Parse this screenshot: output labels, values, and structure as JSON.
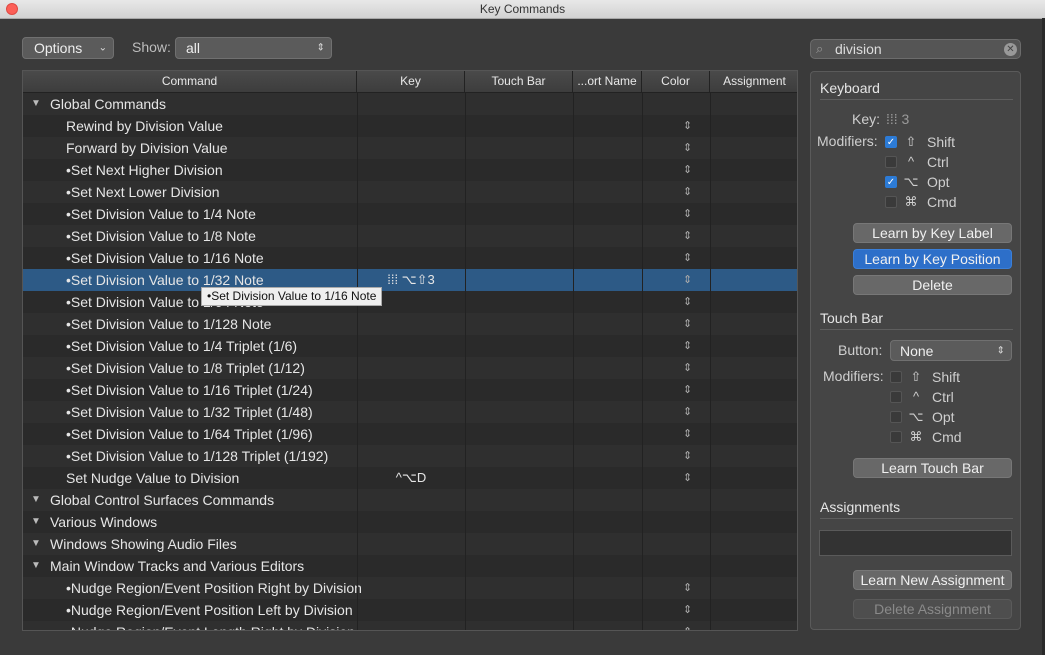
{
  "window": {
    "title": "Key Commands"
  },
  "toolbar": {
    "options_label": "Options",
    "show_label": "Show:",
    "show_value": "all",
    "search_value": "division"
  },
  "table": {
    "headers": [
      "Command",
      "Key",
      "Touch Bar",
      "...ort Name",
      "Color",
      "Assignment"
    ],
    "rows": [
      {
        "text": "Global Commands",
        "key": "",
        "level": 0,
        "group": true,
        "chev": false
      },
      {
        "text": "Rewind by Division Value",
        "key": "",
        "level": 1,
        "chev": true
      },
      {
        "text": "Forward by Division Value",
        "key": "",
        "level": 1,
        "chev": true
      },
      {
        "text": "•Set Next Higher Division",
        "key": "",
        "level": 1,
        "chev": true
      },
      {
        "text": "•Set Next Lower Division",
        "key": "",
        "level": 1,
        "chev": true
      },
      {
        "text": "•Set Division Value to 1/4 Note",
        "key": "",
        "level": 1,
        "chev": true
      },
      {
        "text": "•Set Division Value to 1/8 Note",
        "key": "",
        "level": 1,
        "chev": true
      },
      {
        "text": "•Set Division Value to 1/16 Note",
        "key": "",
        "level": 1,
        "chev": true
      },
      {
        "text": "•Set Division Value to 1/32 Note",
        "key": "⁞⁞⁞ ⌥⇧3",
        "level": 1,
        "chev": true,
        "selected": true
      },
      {
        "text": "•Set Division Value to 1/64 Note",
        "key": "",
        "level": 1,
        "chev": true
      },
      {
        "text": "•Set Division Value to 1/128 Note",
        "key": "",
        "level": 1,
        "chev": true
      },
      {
        "text": "•Set Division Value to 1/4 Triplet (1/6)",
        "key": "",
        "level": 1,
        "chev": true
      },
      {
        "text": "•Set Division Value to 1/8 Triplet (1/12)",
        "key": "",
        "level": 1,
        "chev": true
      },
      {
        "text": "•Set Division Value to 1/16 Triplet (1/24)",
        "key": "",
        "level": 1,
        "chev": true
      },
      {
        "text": "•Set Division Value to 1/32 Triplet (1/48)",
        "key": "",
        "level": 1,
        "chev": true
      },
      {
        "text": "•Set Division Value to 1/64 Triplet (1/96)",
        "key": "",
        "level": 1,
        "chev": true
      },
      {
        "text": "•Set Division Value to 1/128 Triplet (1/192)",
        "key": "",
        "level": 1,
        "chev": true
      },
      {
        "text": "Set Nudge Value to Division",
        "key": "^⌥D",
        "level": 1,
        "chev": true
      },
      {
        "text": "Global Control Surfaces Commands",
        "key": "",
        "level": 0,
        "group": true,
        "chev": false
      },
      {
        "text": "Various Windows",
        "key": "",
        "level": 0,
        "group": true,
        "chev": false
      },
      {
        "text": "Windows Showing Audio Files",
        "key": "",
        "level": 0,
        "group": true,
        "chev": false
      },
      {
        "text": "Main Window Tracks and Various Editors",
        "key": "",
        "level": 0,
        "group": true,
        "chev": false
      },
      {
        "text": "•Nudge Region/Event Position Right by Division",
        "key": "",
        "level": 1,
        "chev": true
      },
      {
        "text": "•Nudge Region/Event Position Left by Division",
        "key": "",
        "level": 1,
        "chev": true
      },
      {
        "text": "•Nudge Region/Event Length Right by Division",
        "key": "",
        "level": 1,
        "chev": true
      }
    ]
  },
  "tooltip": "•Set Division Value to 1/16 Note",
  "keyboard": {
    "title": "Keyboard",
    "key_label": "Key:",
    "key_value": "⁞⁞⁞ 3",
    "modifiers_label": "Modifiers:",
    "modifiers": [
      {
        "symbol": "⇧",
        "label": "Shift",
        "checked": true
      },
      {
        "symbol": "^",
        "label": "Ctrl",
        "checked": false
      },
      {
        "symbol": "⌥",
        "label": "Opt",
        "checked": true
      },
      {
        "symbol": "⌘",
        "label": "Cmd",
        "checked": false
      }
    ],
    "learn_label_btn": "Learn by Key Label",
    "learn_position_btn": "Learn by Key Position",
    "delete_btn": "Delete"
  },
  "touchbar": {
    "title": "Touch Bar",
    "button_label": "Button:",
    "button_value": "None",
    "modifiers_label": "Modifiers:",
    "modifiers": [
      {
        "symbol": "⇧",
        "label": "Shift",
        "checked": false
      },
      {
        "symbol": "^",
        "label": "Ctrl",
        "checked": false
      },
      {
        "symbol": "⌥",
        "label": "Opt",
        "checked": false
      },
      {
        "symbol": "⌘",
        "label": "Cmd",
        "checked": false
      }
    ],
    "learn_btn": "Learn Touch Bar"
  },
  "assignments": {
    "title": "Assignments",
    "learn_new_btn": "Learn New Assignment",
    "delete_btn": "Delete Assignment"
  },
  "colors": {
    "selection": "#2d5a86",
    "accent_blue": "#2d6fc9",
    "checkbox_on": "#2c7bd6"
  }
}
